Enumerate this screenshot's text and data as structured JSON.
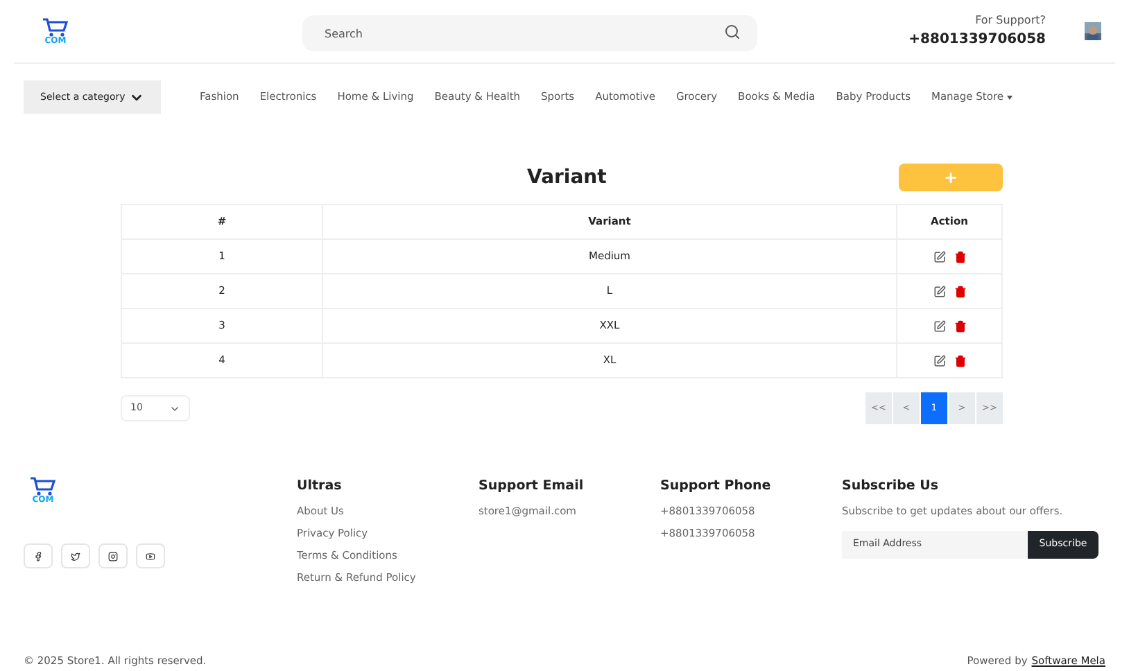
{
  "header": {
    "logo_text": "COM",
    "search": {
      "placeholder": "Search"
    },
    "support_label": "For Support?",
    "support_phone": "+8801339706058"
  },
  "nav": {
    "category_select": "Select a category",
    "items": [
      {
        "label": "Fashion",
        "kind": "link"
      },
      {
        "label": "Electronics",
        "kind": "link"
      },
      {
        "label": "Home & Living",
        "kind": "link"
      },
      {
        "label": "Beauty & Health",
        "kind": "link"
      },
      {
        "label": "Sports",
        "kind": "link"
      },
      {
        "label": "Automotive",
        "kind": "link"
      },
      {
        "label": "Grocery",
        "kind": "link"
      },
      {
        "label": "Books & Media",
        "kind": "link"
      },
      {
        "label": "Baby Products",
        "kind": "link"
      },
      {
        "label": "Manage Store",
        "kind": "dropdown"
      }
    ]
  },
  "page": {
    "title": "Variant",
    "add_button": "+",
    "table": {
      "columns": [
        "#",
        "Variant",
        "Action"
      ],
      "rows": [
        {
          "index": "1",
          "variant": "Medium"
        },
        {
          "index": "2",
          "variant": "L"
        },
        {
          "index": "3",
          "variant": "XXL"
        },
        {
          "index": "4",
          "variant": "XL"
        }
      ]
    },
    "page_size": "10",
    "pagination": [
      {
        "label": "<<",
        "selected": false
      },
      {
        "label": "<",
        "selected": false
      },
      {
        "label": "1",
        "selected": true
      },
      {
        "label": ">",
        "selected": false
      },
      {
        "label": ">>",
        "selected": false
      }
    ]
  },
  "footer": {
    "logo_text": "COM",
    "columns": [
      {
        "title": "Ultras",
        "links": [
          "About Us",
          "Privacy Policy",
          "Terms & Conditions",
          "Return & Refund Policy"
        ]
      },
      {
        "title": "Support Email",
        "links": [
          "store1@gmail.com"
        ]
      },
      {
        "title": "Support Phone",
        "links": [
          "+8801339706058",
          "+8801339706058"
        ]
      }
    ],
    "subscribe": {
      "title": "Subscribe Us",
      "text": "Subscribe to get updates about our offers.",
      "placeholder": "Email Address",
      "button": "Subscribe"
    },
    "copyright": "© 2025 Store1. All rights reserved.",
    "powered_by": "Powered by",
    "powered_link": "Software Mela"
  }
}
